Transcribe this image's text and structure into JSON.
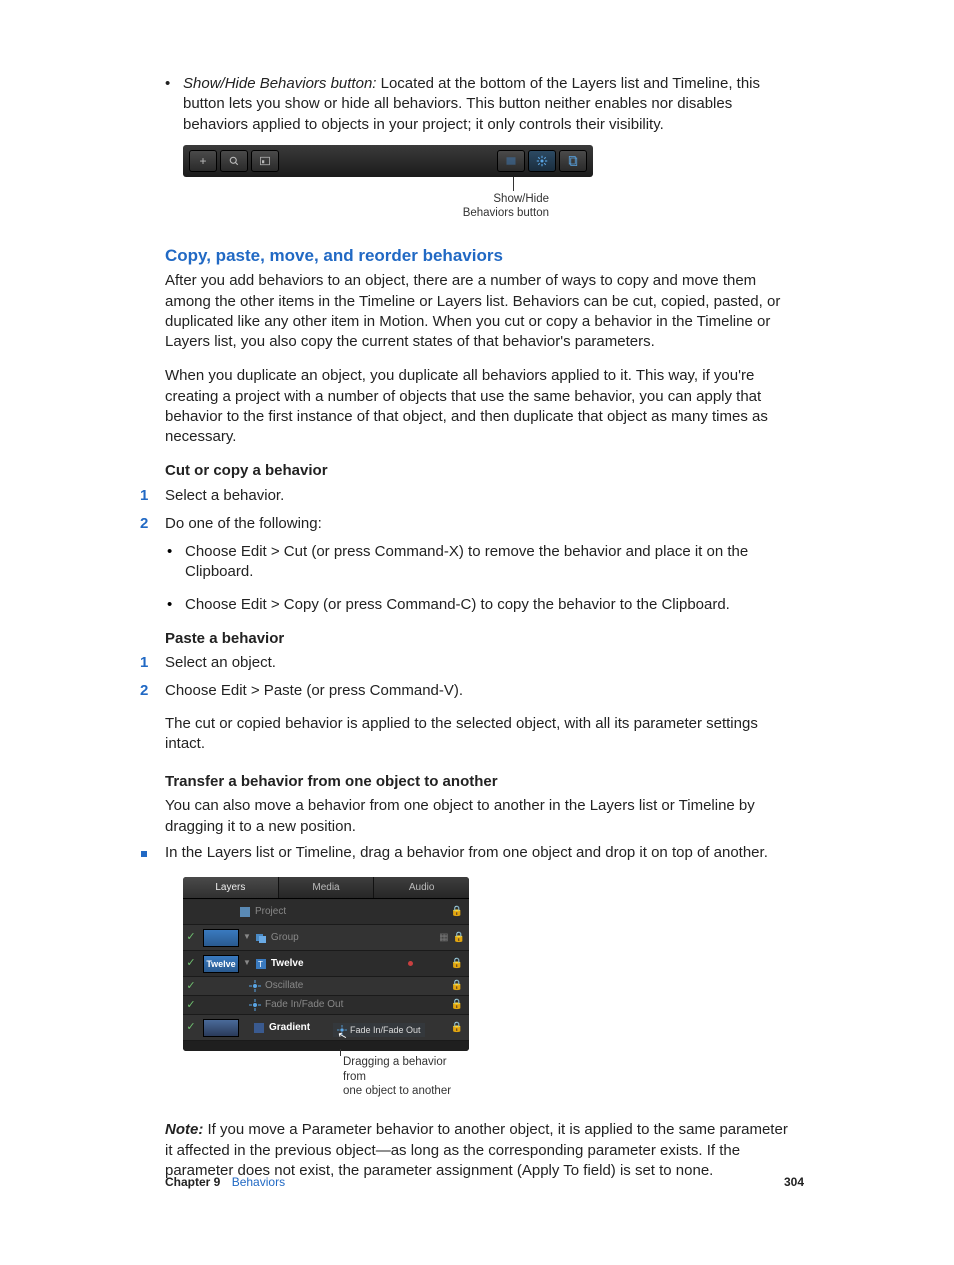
{
  "bullet1": {
    "term": "Show/Hide Behaviors button: ",
    "desc": "Located at the bottom of the Layers list and Timeline, this button lets you show or hide all behaviors. This button neither enables nor disables behaviors applied to objects in your project; it only controls their visibility."
  },
  "toolbar_callout": {
    "l1": "Show/Hide",
    "l2": "Behaviors button"
  },
  "section_heading": "Copy, paste, move, and reorder behaviors",
  "para1": "After you add behaviors to an object, there are a number of ways to copy and move them among the other items in the Timeline or Layers list. Behaviors can be cut, copied, pasted, or duplicated like any other item in Motion. When you cut or copy a behavior in the Timeline or Layers list, you also copy the current states of that behavior's parameters.",
  "para2": "When you duplicate an object, you duplicate all behaviors applied to it. This way, if you're creating a project with a number of objects that use the same behavior, you can apply that behavior to the first instance of that object, and then duplicate that object as many times as necessary.",
  "h_cut": "Cut or copy a behavior",
  "cut_steps": {
    "s1": "Select a behavior.",
    "s2": "Do one of the following:",
    "b1": "Choose Edit > Cut (or press Command-X) to remove the behavior and place it on the Clipboard.",
    "b2": "Choose Edit > Copy (or press Command-C) to copy the behavior to the Clipboard."
  },
  "h_paste": "Paste a behavior",
  "paste_steps": {
    "s1": "Select an object.",
    "s2": "Choose Edit > Paste (or press Command-V).",
    "after": "The cut or copied behavior is applied to the selected object, with all its parameter settings intact."
  },
  "h_transfer": "Transfer a behavior from one object to another",
  "transfer_intro": "You can also move a behavior from one object to another in the Layers list or Timeline by dragging it to a new position.",
  "transfer_step": "In the Layers list or Timeline, drag a behavior from one object and drop it on top of another.",
  "layers_panel": {
    "tabs": {
      "t1": "Layers",
      "t2": "Media",
      "t3": "Audio"
    },
    "rows": {
      "project": "Project",
      "group": "Group",
      "twelve": "Twelve",
      "oscillate": "Oscillate",
      "fade": "Fade In/Fade Out",
      "gradient": "Gradient"
    },
    "thumbs": {
      "twelve": "Twelve"
    },
    "drag_ghost": "Fade In/Fade Out"
  },
  "layers_callout": {
    "l1": "Dragging a behavior from",
    "l2": "one object to another"
  },
  "note": {
    "label": "Note:  ",
    "text": "If you move a Parameter behavior to another object, it is applied to the same parameter it affected in the previous object—as long as the corresponding parameter exists. If the parameter does not exist, the parameter assignment (Apply To field) is set to none."
  },
  "footer": {
    "chapter": "Chapter 9",
    "link": "Behaviors",
    "page": "304"
  }
}
